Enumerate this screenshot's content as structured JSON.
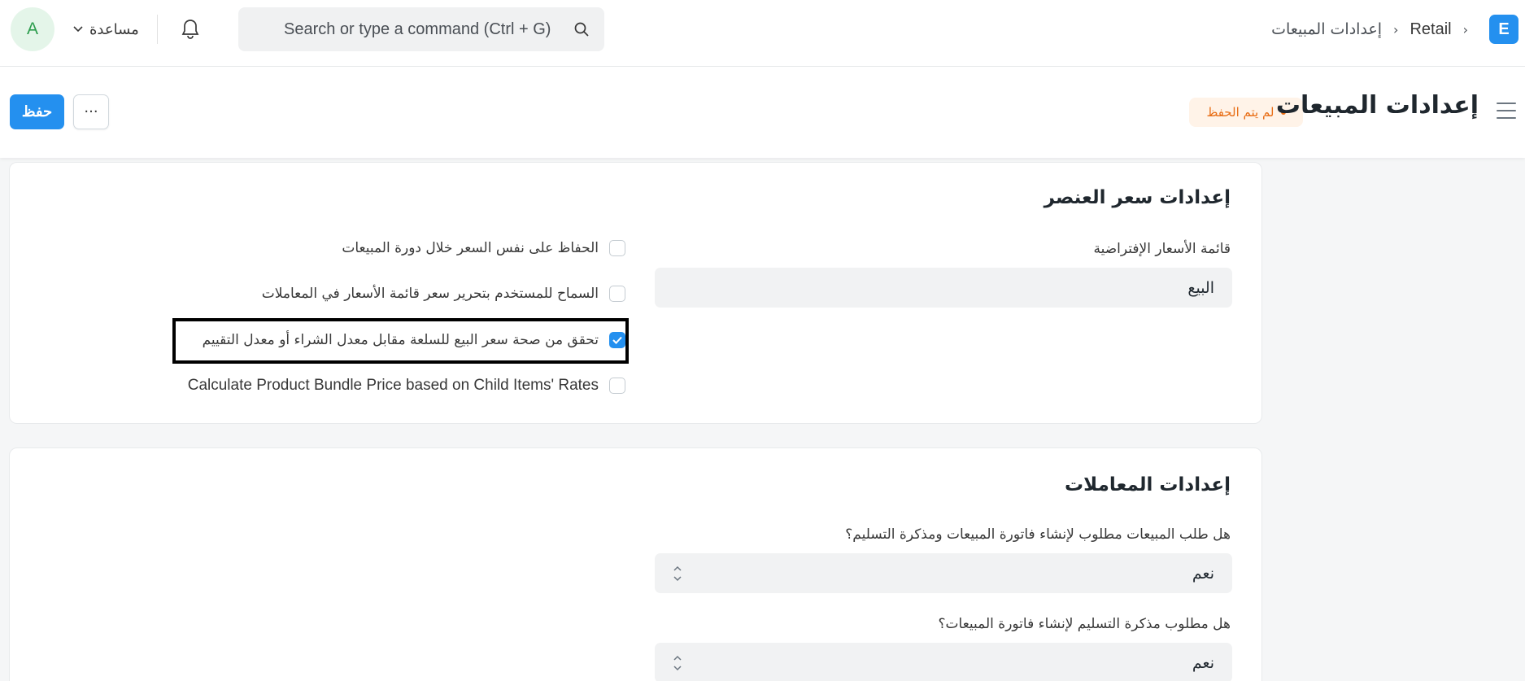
{
  "navbar": {
    "avatar_letter": "A",
    "help_label": "مساعدة",
    "search_placeholder": "Search or type a command (Ctrl + G)",
    "breadcrumb": [
      "Retail",
      "إعدادات المبيعات"
    ],
    "logo_letter": "E",
    "colors": {
      "accent": "#2490ef",
      "avatar_bg": "#e4f5e9",
      "avatar_fg": "#2d9d4e"
    }
  },
  "page_header": {
    "title": "إعدادات المبيعات",
    "status_badge": "لم يتم الحفظ",
    "save_label": "حفظ",
    "more_label": "···",
    "status_color": "#e86c13"
  },
  "item_price_settings": {
    "title": "إعدادات سعر العنصر",
    "default_price_list_label": "قائمة الأسعار الإفتراضية",
    "default_price_list_value": "البيع",
    "checkboxes": [
      {
        "label": "الحفاظ على نفس السعر خلال دورة المبيعات",
        "checked": false
      },
      {
        "label": "السماح للمستخدم بتحرير سعر قائمة الأسعار في المعاملات",
        "checked": false
      },
      {
        "label": "تحقق من صحة سعر البيع للسلعة مقابل معدل الشراء أو معدل التقييم",
        "checked": true
      },
      {
        "label": "Calculate Product Bundle Price based on Child Items' Rates",
        "checked": false
      }
    ]
  },
  "transaction_settings": {
    "title": "إعدادات المعاملات",
    "so_required_label": "هل طلب المبيعات مطلوب لإنشاء فاتورة المبيعات ومذكرة التسليم؟",
    "so_required_value": "نعم",
    "dn_required_label": "هل مطلوب مذكرة التسليم لإنشاء فاتورة المبيعات؟",
    "dn_required_value": "نعم"
  }
}
